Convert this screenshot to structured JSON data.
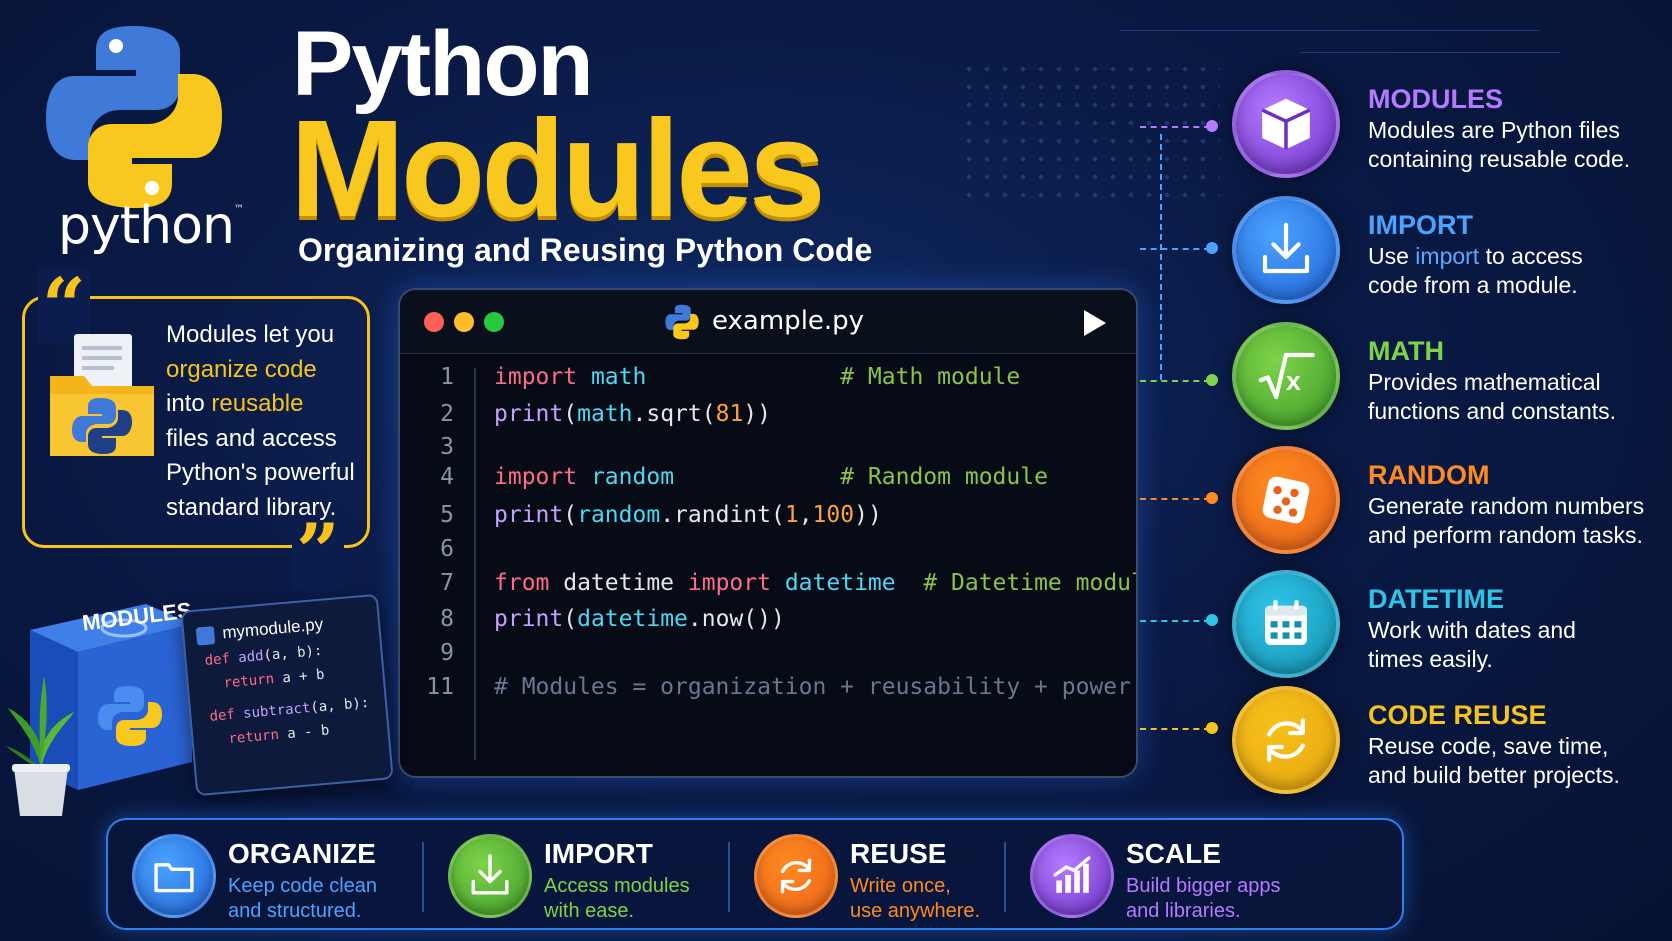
{
  "header": {
    "logo_word": "python",
    "logo_tm": "™",
    "title_line1": "Python",
    "title_line2": "Modules",
    "subtitle": "Organizing and Reusing Python Code"
  },
  "quote": {
    "open_mark": "“",
    "close_mark": "”",
    "lines": [
      {
        "parts": [
          {
            "t": "Modules let you",
            "hl": false
          }
        ]
      },
      {
        "parts": [
          {
            "t": "organize code",
            "hl": true
          }
        ]
      },
      {
        "parts": [
          {
            "t": "into ",
            "hl": false
          },
          {
            "t": "reusable",
            "hl": true
          }
        ]
      },
      {
        "parts": [
          {
            "t": "files and access",
            "hl": false
          }
        ]
      },
      {
        "parts": [
          {
            "t": "Python's powerful",
            "hl": false
          }
        ]
      },
      {
        "parts": [
          {
            "t": "standard library.",
            "hl": false
          }
        ]
      }
    ]
  },
  "editor": {
    "filename": "example.py",
    "run_icon": "play-icon",
    "traffic_colors": [
      "#ff5f57",
      "#febc2e",
      "#28c840"
    ],
    "lines": [
      {
        "n": "1",
        "tokens": [
          [
            "kw",
            "import"
          ],
          [
            "pl",
            " "
          ],
          [
            "md",
            "math"
          ],
          [
            "pl",
            "              "
          ],
          [
            "cm",
            "# Math module"
          ]
        ]
      },
      {
        "n": "2",
        "tokens": [
          [
            "fn",
            "print"
          ],
          [
            "pl",
            "("
          ],
          [
            "md",
            "math"
          ],
          [
            "pl",
            ".sqrt("
          ],
          [
            "num",
            "81"
          ],
          [
            "pl",
            "))"
          ]
        ]
      },
      {
        "n": "3",
        "tokens": []
      },
      {
        "n": "4",
        "tokens": [
          [
            "kw",
            "import"
          ],
          [
            "pl",
            " "
          ],
          [
            "md",
            "random"
          ],
          [
            "pl",
            "            "
          ],
          [
            "cm",
            "# Random module"
          ]
        ]
      },
      {
        "n": "5",
        "tokens": [
          [
            "fn",
            "print"
          ],
          [
            "pl",
            "("
          ],
          [
            "md",
            "random"
          ],
          [
            "pl",
            ".randint("
          ],
          [
            "num",
            "1"
          ],
          [
            "pl",
            ","
          ],
          [
            "num",
            "100"
          ],
          [
            "pl",
            "))"
          ]
        ]
      },
      {
        "n": "6",
        "tokens": []
      },
      {
        "n": "7",
        "tokens": [
          [
            "kw",
            "from"
          ],
          [
            "pl",
            " datetime "
          ],
          [
            "kw",
            "import"
          ],
          [
            "pl",
            " "
          ],
          [
            "md",
            "datetime"
          ],
          [
            "pl",
            "  "
          ],
          [
            "cm",
            "# Datetime module"
          ]
        ]
      },
      {
        "n": "8",
        "tokens": [
          [
            "fn",
            "print"
          ],
          [
            "pl",
            "("
          ],
          [
            "md",
            "datetime"
          ],
          [
            "pl",
            ".now())"
          ]
        ]
      },
      {
        "n": "9",
        "tokens": []
      },
      {
        "n": "11",
        "tokens": [
          [
            "gc",
            "# Modules = organization + reusability + power"
          ]
        ]
      }
    ]
  },
  "features": [
    {
      "title": "MODULES",
      "icon": "cube-icon",
      "color": "#b57bff",
      "bg": "#6a2fc4",
      "desc": [
        [
          [
            "Modules are Python files",
            false
          ]
        ],
        [
          [
            "containing reusable code.",
            false
          ]
        ]
      ]
    },
    {
      "title": "IMPORT",
      "icon": "download-icon",
      "color": "#4ba3ff",
      "bg": "#1f62d6",
      "desc": [
        [
          [
            "Use ",
            false
          ],
          [
            "import",
            true
          ],
          [
            " to access",
            false
          ]
        ],
        [
          [
            "code from a module.",
            false
          ]
        ]
      ]
    },
    {
      "title": "MATH",
      "icon": "square-root-icon",
      "color": "#7ed348",
      "bg": "#3e9a2a",
      "desc": [
        [
          [
            "Provides mathematical",
            false
          ]
        ],
        [
          [
            "functions and constants.",
            false
          ]
        ]
      ]
    },
    {
      "title": "RANDOM",
      "icon": "dice-icon",
      "color": "#ff8a1f",
      "bg": "#e8621a",
      "desc": [
        [
          [
            "Generate random numbers",
            false
          ]
        ],
        [
          [
            "and perform random tasks.",
            false
          ]
        ]
      ]
    },
    {
      "title": "DATETIME",
      "icon": "calendar-icon",
      "color": "#2ec4e8",
      "bg": "#1591b0",
      "desc": [
        [
          [
            "Work with dates and",
            false
          ]
        ],
        [
          [
            "times easily.",
            false
          ]
        ]
      ]
    },
    {
      "title": "CODE REUSE",
      "icon": "refresh-icon",
      "color": "#f6c21b",
      "bg": "#e6a310",
      "desc": [
        [
          [
            "Reuse code, save time,",
            false
          ]
        ],
        [
          [
            "and build better projects.",
            false
          ]
        ]
      ]
    }
  ],
  "bottom": [
    {
      "title": "ORGANIZE",
      "icon": "folder-icon",
      "color": "#4ba3ff",
      "bg": "#1f62d6",
      "desc": [
        "Keep code clean",
        "and structured."
      ]
    },
    {
      "title": "IMPORT",
      "icon": "download-icon",
      "color": "#7ed348",
      "bg": "#3e9a2a",
      "desc": [
        "Access modules",
        "with ease."
      ]
    },
    {
      "title": "REUSE",
      "icon": "refresh-icon",
      "color": "#ff8a1f",
      "bg": "#e8621a",
      "desc": [
        "Write once,",
        "use anywhere."
      ]
    },
    {
      "title": "SCALE",
      "icon": "bar-chart-icon",
      "color": "#b57bff",
      "bg": "#6a2fc4",
      "desc": [
        "Build bigger apps",
        "and libraries."
      ]
    }
  ],
  "illustration": {
    "cube_label": "MODULES",
    "card_title": "mymodule.py",
    "card_lines": [
      [
        [
          "kw",
          "def "
        ],
        [
          "fn",
          "add"
        ],
        [
          "pl",
          "(a, b):"
        ]
      ],
      [
        [
          "kw",
          "  return "
        ],
        [
          "pl",
          "a + b"
        ]
      ],
      [
        [
          "pl",
          ""
        ]
      ],
      [
        [
          "kw",
          "def "
        ],
        [
          "fn",
          "subtract"
        ],
        [
          "pl",
          "(a, b):"
        ]
      ],
      [
        [
          "kw",
          "  return "
        ],
        [
          "pl",
          "a - b"
        ]
      ]
    ]
  }
}
